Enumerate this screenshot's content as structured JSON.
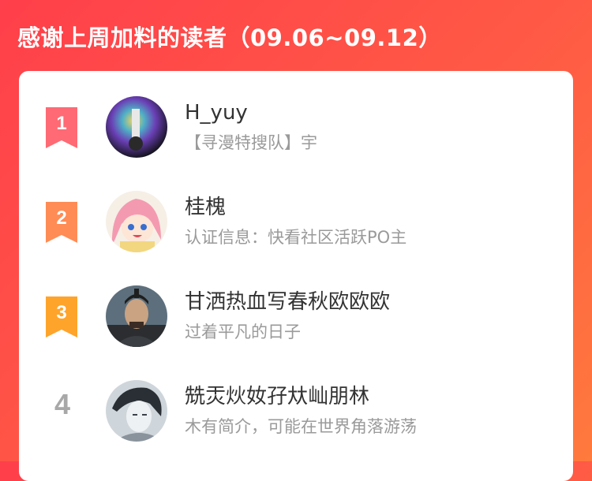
{
  "header": {
    "title": "感谢上周加料的读者（09.06~09.12）"
  },
  "colors": {
    "background_start": "#ff3f4b",
    "background_end": "#ff7a3d",
    "rank1": "#ff6a74",
    "rank2": "#ff8c55",
    "rank3": "#ffa42a",
    "rank_plain": "#a8a8a8"
  },
  "readers": [
    {
      "rank": "1",
      "name": "H_yuy",
      "desc": "【寻漫特搜队】宇",
      "avatar": "avatar-dark-abstract"
    },
    {
      "rank": "2",
      "name": "桂槐",
      "desc": "认证信息：快看社区活跃PO主",
      "avatar": "avatar-anime-pink-hair"
    },
    {
      "rank": "3",
      "name": "甘洒热血写春秋欧欧欧",
      "desc": "过着平凡的日子",
      "avatar": "avatar-warrior"
    },
    {
      "rank": "4",
      "name": "兟㶣炏奻孖夶屾朋林",
      "desc": "木有简介，可能在世界角落游荡",
      "avatar": "avatar-sketch-boy"
    }
  ]
}
